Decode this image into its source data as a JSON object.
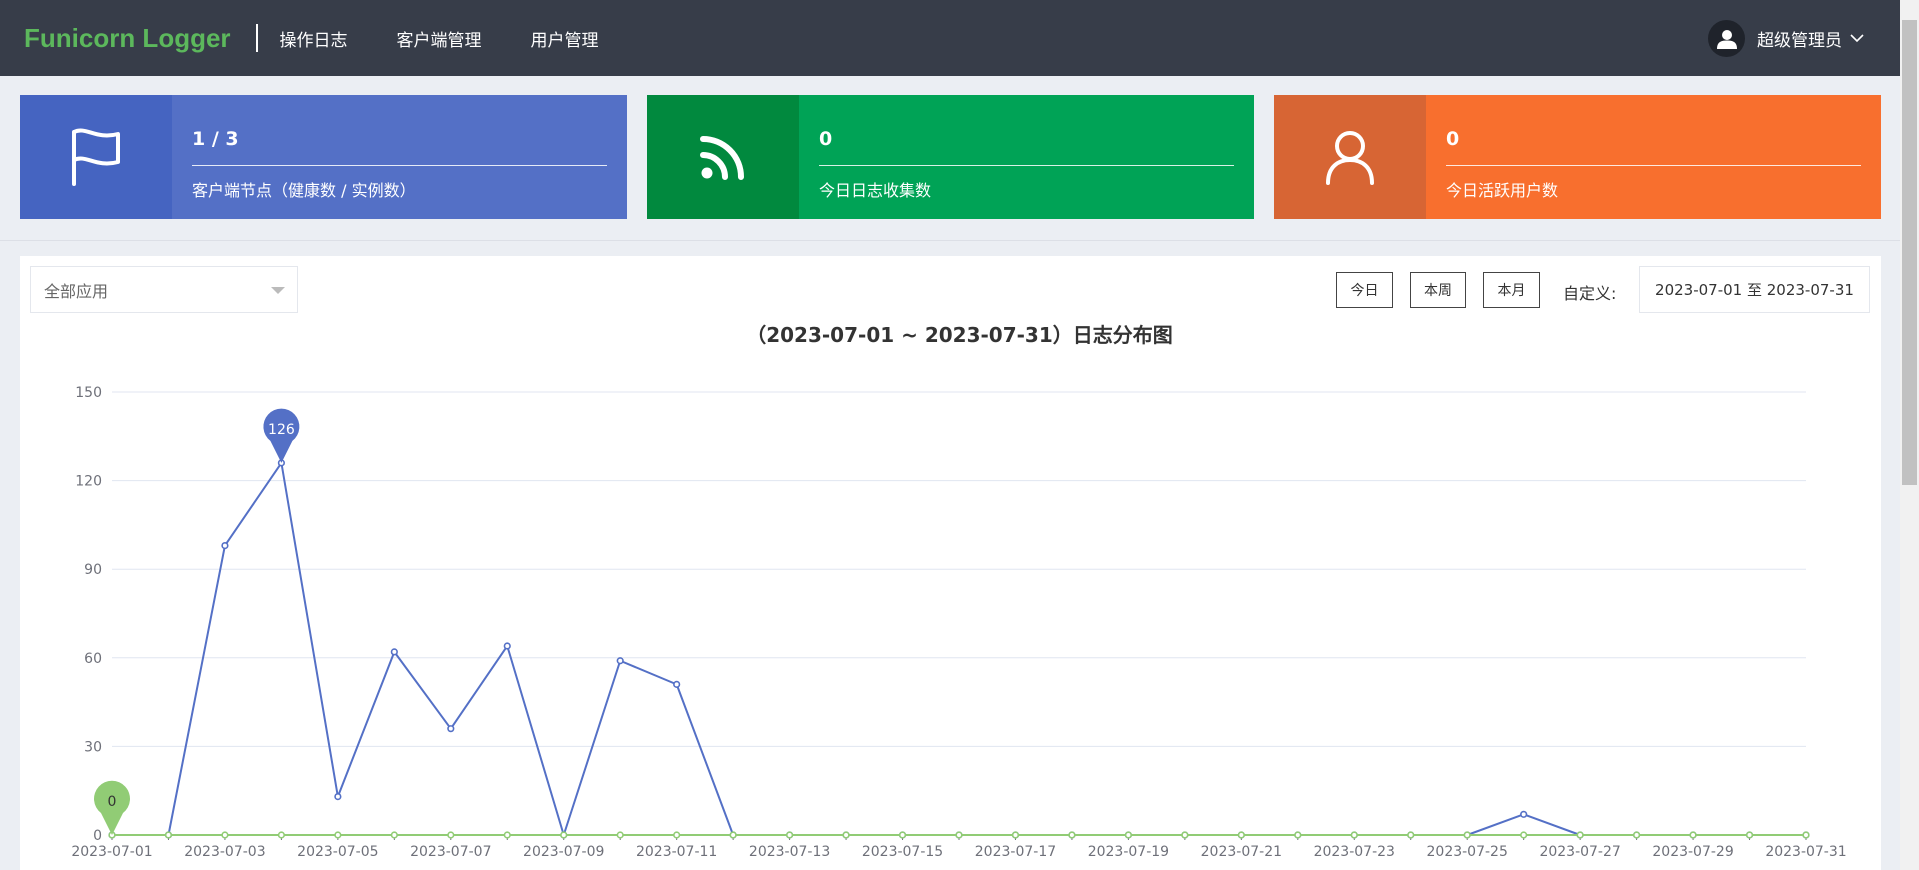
{
  "nav": {
    "brand": "Funicorn Logger",
    "items": [
      "操作日志",
      "客户端管理",
      "用户管理"
    ],
    "user": "超级管理员"
  },
  "cards": [
    {
      "icon": "flag-icon",
      "value": "1 / 3",
      "label": "客户端节点（健康数 / 实例数）",
      "icon_color": "#4564c1",
      "color": "#5470c6"
    },
    {
      "icon": "rss-icon",
      "value": "0",
      "label": "今日日志收集数",
      "icon_color": "#01893e",
      "color": "#00a356"
    },
    {
      "icon": "user-icon",
      "value": "0",
      "label": "今日活跃用户数",
      "icon_color": "#d76534",
      "color": "#f86f2e"
    }
  ],
  "filters": {
    "app_select": "全部应用",
    "today": "今日",
    "week": "本周",
    "month": "本月",
    "custom_label": "自定义:",
    "date_range": "2023-07-01 至 2023-07-31"
  },
  "chart_data": {
    "type": "line",
    "title": "（2023-07-01 ~ 2023-07-31）日志分布图",
    "x": [
      "2023-07-01",
      "2023-07-02",
      "2023-07-03",
      "2023-07-04",
      "2023-07-05",
      "2023-07-06",
      "2023-07-07",
      "2023-07-08",
      "2023-07-09",
      "2023-07-10",
      "2023-07-11",
      "2023-07-12",
      "2023-07-13",
      "2023-07-14",
      "2023-07-15",
      "2023-07-16",
      "2023-07-17",
      "2023-07-18",
      "2023-07-19",
      "2023-07-20",
      "2023-07-21",
      "2023-07-22",
      "2023-07-23",
      "2023-07-24",
      "2023-07-25",
      "2023-07-26",
      "2023-07-27",
      "2023-07-28",
      "2023-07-29",
      "2023-07-30",
      "2023-07-31"
    ],
    "x_tick_labels": [
      "2023-07-01",
      "2023-07-03",
      "2023-07-05",
      "2023-07-07",
      "2023-07-09",
      "2023-07-11",
      "2023-07-13",
      "2023-07-15",
      "2023-07-17",
      "2023-07-19",
      "2023-07-21",
      "2023-07-23",
      "2023-07-25",
      "2023-07-27",
      "2023-07-29",
      "2023-07-31"
    ],
    "yticks": [
      0,
      30,
      60,
      90,
      120,
      150
    ],
    "ylim": [
      0,
      150
    ],
    "grid": true,
    "series": [
      {
        "color": "#5470c6",
        "values": [
          0,
          0,
          98,
          126,
          13,
          62,
          36,
          64,
          0,
          59,
          51,
          0,
          0,
          0,
          0,
          0,
          0,
          0,
          0,
          0,
          0,
          0,
          0,
          0,
          0,
          7,
          0,
          0,
          0,
          0,
          0
        ],
        "max_marker": {
          "index": 3,
          "label": "126"
        }
      },
      {
        "color": "#91cc75",
        "values": [
          0,
          0,
          0,
          0,
          0,
          0,
          0,
          0,
          0,
          0,
          0,
          0,
          0,
          0,
          0,
          0,
          0,
          0,
          0,
          0,
          0,
          0,
          0,
          0,
          0,
          0,
          0,
          0,
          0,
          0,
          0
        ],
        "max_marker": {
          "index": 0,
          "label": "0"
        }
      }
    ]
  }
}
